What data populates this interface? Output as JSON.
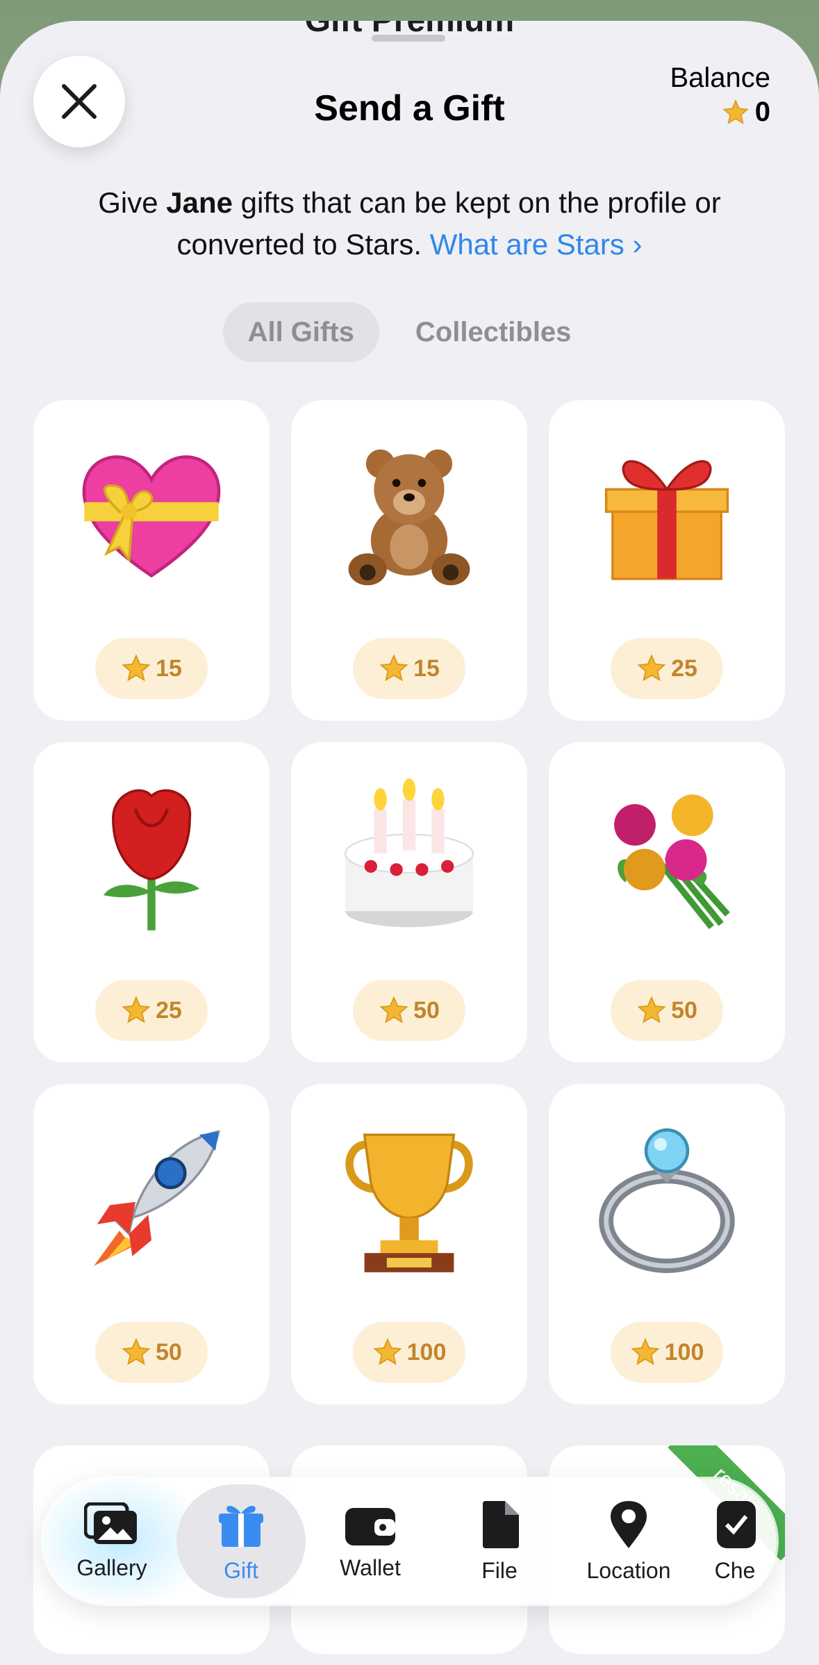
{
  "header": {
    "peek_title": "Gift Premium",
    "title": "Send a Gift",
    "balance_label": "Balance",
    "balance_value": "0"
  },
  "description": {
    "prefix": "Give ",
    "name": "Jane",
    "middle": " gifts that can be kept on the profile or converted to Stars. ",
    "link": "What are Stars",
    "link_chevron": "›"
  },
  "tabs": [
    {
      "label": "All Gifts",
      "active": true
    },
    {
      "label": "Collectibles",
      "active": false
    }
  ],
  "gifts": [
    {
      "icon": "heart-gift-icon",
      "price": "15"
    },
    {
      "icon": "teddy-bear-icon",
      "price": "15"
    },
    {
      "icon": "gift-box-icon",
      "price": "25"
    },
    {
      "icon": "rose-icon",
      "price": "25"
    },
    {
      "icon": "birthday-cake-icon",
      "price": "50"
    },
    {
      "icon": "bouquet-icon",
      "price": "50"
    },
    {
      "icon": "rocket-icon",
      "price": "50"
    },
    {
      "icon": "trophy-icon",
      "price": "100"
    },
    {
      "icon": "ring-icon",
      "price": "100"
    }
  ],
  "partial_badge": "resale",
  "tabbar": [
    {
      "label": "Gallery",
      "icon": "gallery-icon",
      "active": false
    },
    {
      "label": "Gift",
      "icon": "gift-icon",
      "active": true
    },
    {
      "label": "Wallet",
      "icon": "wallet-icon",
      "active": false
    },
    {
      "label": "File",
      "icon": "file-icon",
      "active": false
    },
    {
      "label": "Location",
      "icon": "location-icon",
      "active": false
    },
    {
      "label": "Che",
      "icon": "checklist-icon",
      "active": false
    }
  ],
  "colors": {
    "accent": "#2f88e8",
    "price_bg": "#fcefd6",
    "price_text": "#c1852c",
    "star": "#f5b731",
    "resale": "#4caf50"
  }
}
